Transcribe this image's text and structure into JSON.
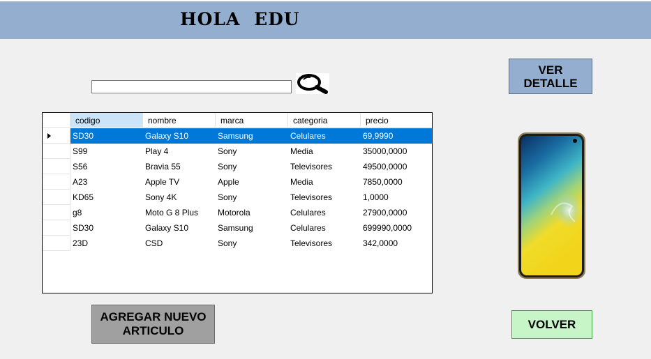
{
  "header": {
    "title": "HOLA   EDU"
  },
  "search": {
    "value": "",
    "placeholder": ""
  },
  "grid": {
    "columns": [
      "codigo",
      "nombre",
      "marca",
      "categoria",
      "precio"
    ],
    "rows": [
      [
        "SD30",
        "Galaxy S10",
        "Samsung",
        "Celulares",
        "69,9990"
      ],
      [
        "S99",
        "Play 4",
        "Sony",
        "Media",
        "35000,0000"
      ],
      [
        "S56",
        "Bravia 55",
        "Sony",
        "Televisores",
        "49500,0000"
      ],
      [
        "A23",
        "Apple TV",
        "Apple",
        "Media",
        "7850,0000"
      ],
      [
        "KD65",
        "Sony 4K",
        "Sony",
        "Televisores",
        "1,0000"
      ],
      [
        "g8",
        "Moto G 8 Plus",
        "Motorola",
        "Celulares",
        "27900,0000"
      ],
      [
        "SD30",
        "Galaxy S10",
        "Samsung",
        "Celulares",
        "699990,0000"
      ],
      [
        "23D",
        "CSD",
        "Sony",
        "Televisores",
        "342,0000"
      ]
    ],
    "selected_row": 0
  },
  "buttons": {
    "ver_detalle_line1": "VER",
    "ver_detalle_line2": "DETALLE",
    "agregar_line1": "AGREGAR NUEVO",
    "agregar_line2": "ARTICULO",
    "volver": "VOLVER"
  },
  "colors": {
    "header_bg": "#94aecf",
    "selection": "#0078d7",
    "volver_bg": "#c8f5c8",
    "agregar_bg": "#a0a0a0"
  },
  "icons": {
    "search": "magnifier-icon",
    "row_pointer": "row-pointer-icon"
  }
}
